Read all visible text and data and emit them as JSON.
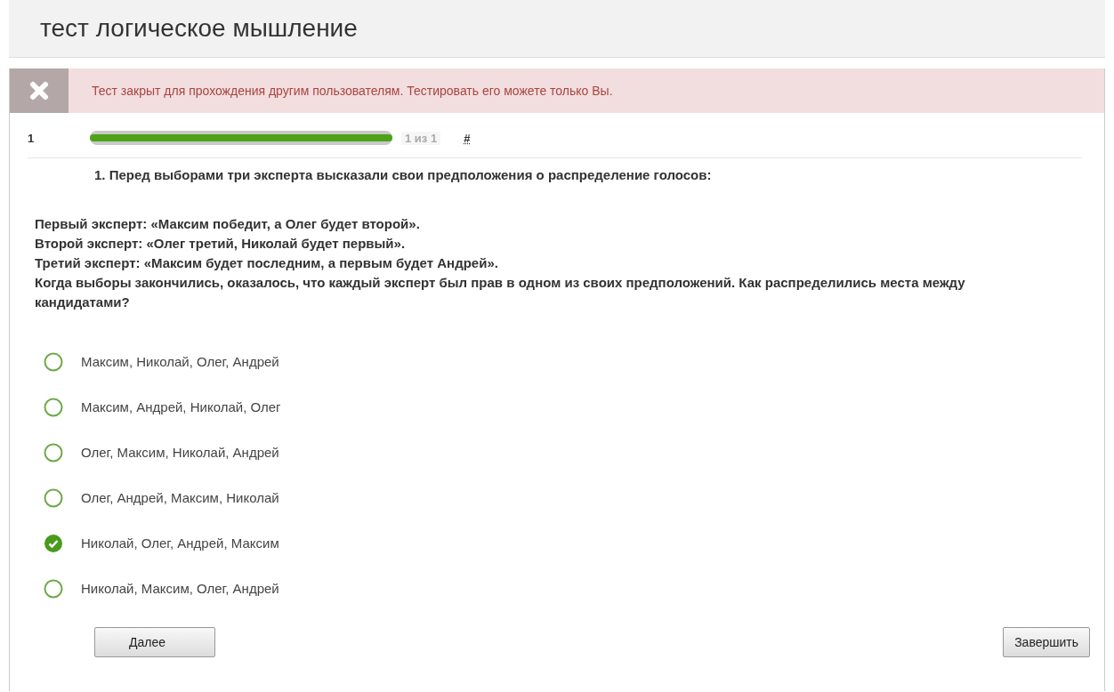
{
  "title": "тест логическое мышление",
  "alert": {
    "text": "Тест закрыт для прохождения другим пользователям. Тестировать его можете только Вы."
  },
  "progress": {
    "number": "1",
    "level": 1,
    "counter": "1 из 1",
    "hash": "#"
  },
  "question": {
    "heading": "1. Перед выборами три эксперта высказали свои предположения о распределение голосов:",
    "lines": [
      "Первый эксперт: «Максим победит, а Олег будет второй».",
      "Второй эксперт: «Олег третий, Николай будет первый».",
      "Третий эксперт: «Максим будет последним, а первым будет Андрей».",
      "Когда выборы закончились, оказалось, что каждый эксперт был прав в одном из своих предположений. Как распределились места между кандидатами?"
    ]
  },
  "options": [
    {
      "label": "Максим, Николай, Олег, Андрей",
      "selected": false
    },
    {
      "label": "Максим, Андрей, Николай, Олег",
      "selected": false
    },
    {
      "label": "Олег, Максим, Николай, Андрей",
      "selected": false
    },
    {
      "label": "Олег, Андрей, Максим, Николай",
      "selected": false
    },
    {
      "label": "Николай, Олег, Андрей, Максим",
      "selected": true
    },
    {
      "label": "Николай, Максим, Олег, Андрей",
      "selected": false
    }
  ],
  "buttons": {
    "next": "Далее",
    "finish": "Завершить"
  }
}
